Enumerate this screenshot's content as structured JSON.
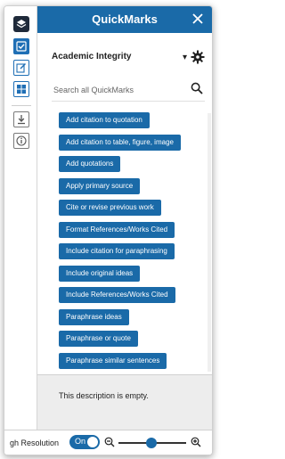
{
  "header": {
    "title": "QuickMarks"
  },
  "set_selector": {
    "value": "Academic Integrity"
  },
  "search": {
    "placeholder": "Search all QuickMarks",
    "value": ""
  },
  "quickmarks": [
    "Add citation to quotation",
    "Add citation to table, figure, image",
    "Add quotations",
    "Apply primary source",
    "Cite or revise previous work",
    "Format References/Works Cited",
    "Include citation for paraphrasing",
    "Include original ideas",
    "Include References/Works Cited",
    "Paraphrase ideas",
    "Paraphrase or quote",
    "Paraphrase similar sentences"
  ],
  "description": {
    "text": "This description is empty."
  },
  "footer": {
    "resolution_label": "gh Resolution",
    "toggle_label": "On",
    "zoom_level": 0.48
  },
  "colors": {
    "accent": "#1a6aa8",
    "rail_dark": "#1f2a3a"
  },
  "icons": {
    "rail": [
      "layers-icon",
      "checkbox-icon",
      "edit-icon",
      "grid-icon",
      "download-icon",
      "info-icon"
    ]
  }
}
